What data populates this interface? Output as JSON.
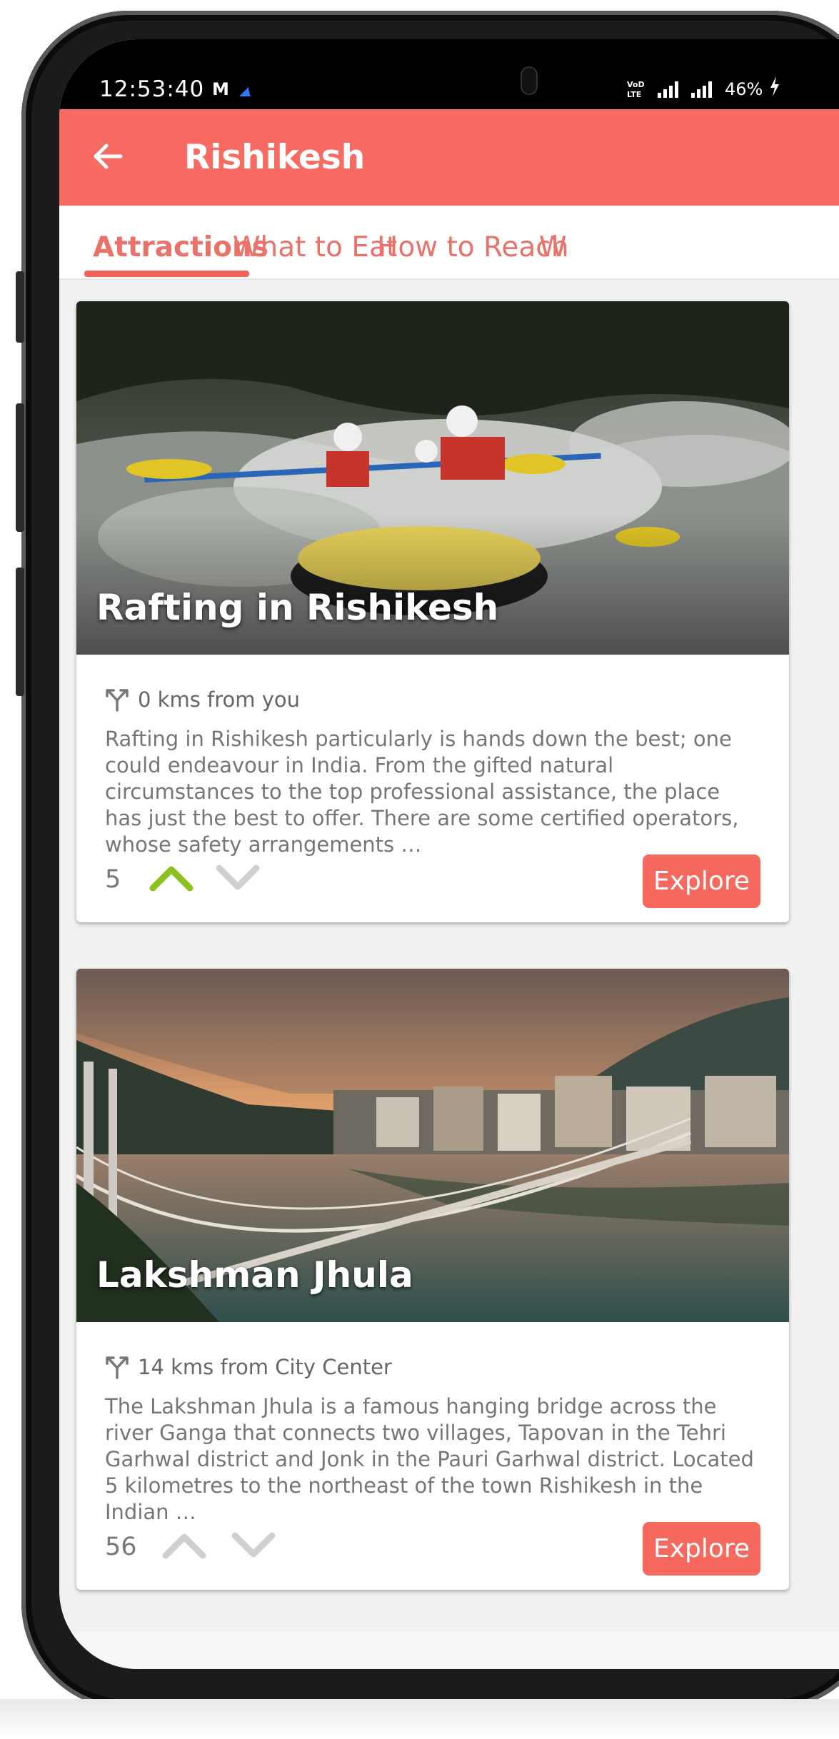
{
  "status_bar": {
    "time": "12:53:40",
    "mail_icon": "M",
    "network_label": "VoD LTE",
    "battery": "46%",
    "icons": [
      "mail-icon",
      "navigation-icon",
      "volte-icon",
      "signal-icon",
      "signal-icon",
      "charging-bolt-icon"
    ]
  },
  "app_bar": {
    "title": "Rishikesh",
    "back_icon": "arrow-left-icon",
    "background": "#f76b63"
  },
  "tabs": [
    {
      "label": "Attractions",
      "active": true
    },
    {
      "label": "What to Eat",
      "active": false
    },
    {
      "label": "How to Reach",
      "active": false
    },
    {
      "label": "W",
      "active": false
    }
  ],
  "cards": [
    {
      "title": "Rafting in Rishikesh",
      "distance": "0 kms from you",
      "description": "Rafting in Rishikesh particularly is hands down the best; one could endeavour in India. From the gifted natural circumstances to the top professional assistance, the place has just the best to offer. There are some certified operators, whose safety arrangements …",
      "votes": "5",
      "upvoted": true,
      "explore_label": "Explore"
    },
    {
      "title": "Lakshman Jhula",
      "distance": "14 kms from City Center",
      "description": "The Lakshman Jhula is a famous hanging bridge across the river Ganga that connects two villages, Tapovan in the Tehri Garhwal district and Jonk in the Pauri Garhwal district. Located 5 kilometres to the northeast of the town Rishikesh in the Indian …",
      "votes": "56",
      "upvoted": false,
      "explore_label": "Explore"
    }
  ],
  "colors": {
    "accent": "#f76b63",
    "tab_text": "#e9726b",
    "upvote_active": "#8cc21b",
    "vote_inactive": "#cfcfcf"
  }
}
